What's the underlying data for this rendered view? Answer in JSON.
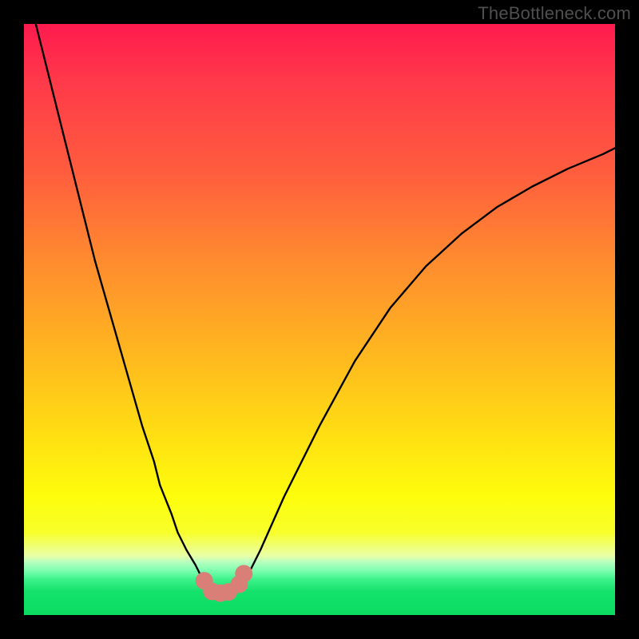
{
  "watermark": "TheBottleneck.com",
  "chart_data": {
    "type": "line",
    "title": "",
    "xlabel": "",
    "ylabel": "",
    "xlim": [
      0,
      100
    ],
    "ylim": [
      0,
      100
    ],
    "grid": false,
    "legend": false,
    "series": [
      {
        "name": "bottleneck-curve",
        "x": [
          2,
          4,
          6,
          8,
          10,
          12,
          14,
          16,
          18,
          20,
          22,
          23,
          25,
          26,
          27.5,
          29,
          30,
          31,
          31.7,
          32.5,
          33.5,
          35,
          36,
          36.8,
          38,
          40,
          44,
          50,
          56,
          62,
          68,
          74,
          80,
          86,
          92,
          98,
          100
        ],
        "y": [
          100,
          92,
          84,
          76,
          68,
          60,
          53,
          46,
          39,
          32,
          26,
          22,
          17,
          14,
          11,
          8.5,
          6.5,
          5,
          4.2,
          3.8,
          3.6,
          3.6,
          4,
          5,
          7,
          11,
          20,
          32,
          43,
          52,
          59,
          64.5,
          69,
          72.5,
          75.5,
          78,
          79
        ]
      }
    ],
    "markers": [
      {
        "name": "trough-left",
        "x": 30.5,
        "y": 5.8,
        "size": 11,
        "color": "#d97f78"
      },
      {
        "name": "trough-bottom1",
        "x": 31.8,
        "y": 4.0,
        "size": 11,
        "color": "#d97f78"
      },
      {
        "name": "trough-bottom2",
        "x": 33.2,
        "y": 3.7,
        "size": 11,
        "color": "#d97f78"
      },
      {
        "name": "trough-bottom3",
        "x": 34.6,
        "y": 3.9,
        "size": 11,
        "color": "#d97f78"
      },
      {
        "name": "trough-right",
        "x": 36.4,
        "y": 5.2,
        "size": 11,
        "color": "#d97f78"
      },
      {
        "name": "trough-right2",
        "x": 37.2,
        "y": 7.0,
        "size": 11,
        "color": "#d97f78"
      }
    ],
    "background_gradient": {
      "direction": "vertical",
      "stops": [
        {
          "pos": 0.0,
          "color": "#ff1b4e"
        },
        {
          "pos": 0.55,
          "color": "#ffb520"
        },
        {
          "pos": 0.86,
          "color": "#f8ff2a"
        },
        {
          "pos": 0.94,
          "color": "#3cf28a"
        },
        {
          "pos": 1.0,
          "color": "#0bdc61"
        }
      ]
    }
  }
}
